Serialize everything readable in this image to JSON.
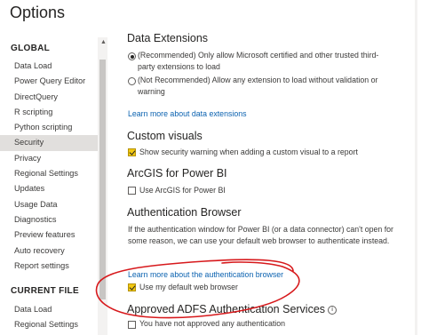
{
  "window": {
    "title": "Options"
  },
  "sidebar": {
    "global_heading": "GLOBAL",
    "global_items": [
      {
        "label": "Data Load",
        "selected": false
      },
      {
        "label": "Power Query Editor",
        "selected": false
      },
      {
        "label": "DirectQuery",
        "selected": false
      },
      {
        "label": "R scripting",
        "selected": false
      },
      {
        "label": "Python scripting",
        "selected": false
      },
      {
        "label": "Security",
        "selected": true
      },
      {
        "label": "Privacy",
        "selected": false
      },
      {
        "label": "Regional Settings",
        "selected": false
      },
      {
        "label": "Updates",
        "selected": false
      },
      {
        "label": "Usage Data",
        "selected": false
      },
      {
        "label": "Diagnostics",
        "selected": false
      },
      {
        "label": "Preview features",
        "selected": false
      },
      {
        "label": "Auto recovery",
        "selected": false
      },
      {
        "label": "Report settings",
        "selected": false
      }
    ],
    "current_file_heading": "CURRENT FILE",
    "current_file_items": [
      {
        "label": "Data Load"
      },
      {
        "label": "Regional Settings"
      }
    ]
  },
  "main": {
    "data_extensions": {
      "heading": "Data Extensions",
      "option_recommended": "(Recommended) Only allow Microsoft certified and other trusted third-party extensions to load",
      "option_recommended_selected": true,
      "option_not_recommended": "(Not Recommended) Allow any extension to load without validation or warning",
      "option_not_recommended_selected": false,
      "learn_more": "Learn more about data extensions"
    },
    "custom_visuals": {
      "heading": "Custom visuals",
      "checkbox_label": "Show security warning when adding a custom visual to a report",
      "checked": true
    },
    "arcgis": {
      "heading": "ArcGIS for Power BI",
      "checkbox_label": "Use ArcGIS for Power BI",
      "checked": false
    },
    "auth_browser": {
      "heading": "Authentication Browser",
      "description": "If the authentication window for Power BI (or a data connector) can't open for some reason, we can use your default web browser to authenticate instead.",
      "learn_more": "Learn more about the authentication browser",
      "checkbox_label": "Use my default web browser",
      "checked": true
    },
    "adfs": {
      "heading": "Approved ADFS Authentication Services",
      "info_icon": "info-icon",
      "status_text": "You have not approved any authentication"
    }
  },
  "colors": {
    "accent_yellow": "#f2c811",
    "link_blue": "#0b62b0",
    "selected_bg": "#e1dfdd",
    "annotation_red": "#d7191c"
  }
}
